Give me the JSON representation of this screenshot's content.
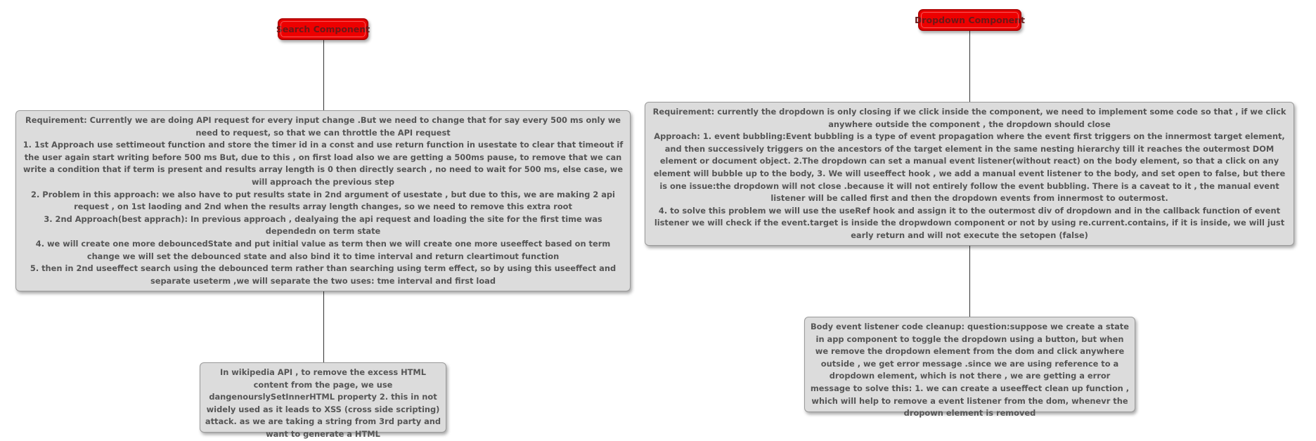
{
  "search": {
    "title": "Search Component",
    "notes": [
      "Requirement: Currently we are doing API request for every input change .But we need to change that for say every 500 ms only we need to request, so that we can throttle the API request",
      "1. 1st Approach use settimeout function and store the timer id in a const and use return function in usestate to clear that timeout if the user again start writing before 500 ms But, due to this , on first load also we are getting a 500ms pause, to remove that we can write a condition that if term is present and results array length is 0 then directly search , no need to wait for 500 ms, else case, we will approach the previous step",
      "2. Problem in this approach: we also have to put results state in 2nd argument of usestate , but due to this, we are making 2 api request , on 1st laoding  and 2nd when the results array length changes, so we need to remove this extra root",
      "3. 2nd Approach(best apprach): In previous approach , dealyaing the api request and loading the site for the first time was dependedn on term state",
      "4. we will create one more debouncedState and put initial  value as term then we will create one more useeffect based on term change we will set the debounced state and also bind it to time interval and return cleartimout function",
      "5. then in 2nd useeffect search using the debounced term rather than searching using term effect, so by using this useeffect and separate useterm ,we will separate the two uses: tme interval and first load"
    ],
    "child_note": "In wikipedia API , to remove the excess HTML content from the page, we use dangenourslySetInnerHTML property 2. this in not widely used as it leads to XSS (cross side scripting) attack. as we are taking a string from 3rd party and want to generate a HTML"
  },
  "dropdown": {
    "title": "Dropdown Component",
    "notes": [
      "Requirement: currently the dropdown is only closing if we click inside the component, we need to implement some code so that , if we click anywhere outside the component , the dropdown should close",
      "Approach:  1. event bubbling:Event bubbling is a type of event propagation where the event first triggers on the innermost target element, and then successively triggers on the ancestors of the target element in the same nesting hierarchy till it reaches the outermost DOM element or document object. 2.The dropdown can set  a manual event listener(without react) on the body element, so that  a click on any element will bubble up to the body, 3. We will useeffect hook , we add a manual event listener to the body, and set open to false, but there is one issue:the dropdown will not close .because it will not entirely follow the event bubbling. There is a caveat to it , the manual event listener will be called first and then the dropdown events from innermost to outermost.",
      "4. to solve this problem we will use the useRef hook and assign it to the outermost div of dropdown and in the callback function of event listener we will check if the event.target is inside the dropwdown component or not by using re.current.contains, if it is inside, we will just early return and will not execute the setopen (false)"
    ],
    "child_note": "Body event listener code cleanup: question:suppose we create a state in app component to toggle the dropdown using a button, but when we remove the dropdown element from the dom and click anywhere outside , we get error message .since we are using reference to a dropdown element, which is not there , we are getting a error message to solve this: 1. we can create a useeffect clean up function , which will help to remove a event listener from the dom, whenevr the dropown element is removed"
  },
  "colors": {
    "title_fill": "#ee0000",
    "title_text": "#6a1a1a",
    "note_fill": "#dcdcdc",
    "note_text": "#555555",
    "line": "#333333"
  }
}
